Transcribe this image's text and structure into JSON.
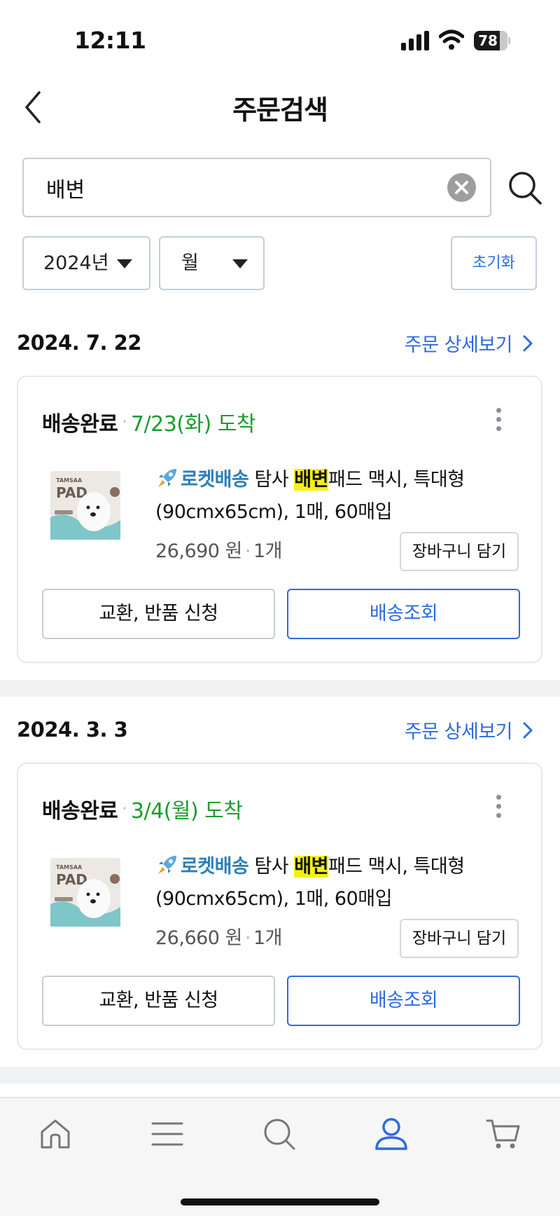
{
  "status_bar": {
    "time": "12:11",
    "battery": "78",
    "battery_level": 0.78
  },
  "header": {
    "title": "주문검색"
  },
  "search": {
    "value": "배변"
  },
  "filters": {
    "year": "2024년",
    "month": "월",
    "reset_label": "초기화"
  },
  "colors": {
    "accent": "#2d6be0",
    "arrival": "#1a9c2e",
    "highlight": "#f5f10e",
    "rocket": "#2f7fb8"
  },
  "orders": [
    {
      "date": "2024. 7. 22",
      "detail_label": "주문 상세보기",
      "status": "배송완료",
      "arrival": "7/23(화) 도착",
      "rocket_label": "로켓배송",
      "title_before": "탐사 ",
      "title_highlight": "배변",
      "title_after": "패드 맥시, 특대형 (90cmx65cm), 1매, 60매입",
      "price": "26,690 원",
      "quantity": "1개",
      "cart_label": "장바구니 담기",
      "exchange_label": "교환, 반품 신청",
      "tracking_label": "배송조회"
    },
    {
      "date": "2024. 3. 3",
      "detail_label": "주문 상세보기",
      "status": "배송완료",
      "arrival": "3/4(월) 도착",
      "rocket_label": "로켓배송",
      "title_before": "탐사 ",
      "title_highlight": "배변",
      "title_after": "패드 맥시, 특대형 (90cmx65cm), 1매, 60매입",
      "price": "26,660 원",
      "quantity": "1개",
      "cart_label": "장바구니 담기",
      "exchange_label": "교환, 반품 신청",
      "tracking_label": "배송조회"
    }
  ],
  "product_thumb": {
    "brand": "TAMSAA",
    "name": "PAD"
  },
  "bottom_nav": {
    "items": [
      {
        "icon": "home-icon",
        "active": false
      },
      {
        "icon": "menu-icon",
        "active": false
      },
      {
        "icon": "search-icon",
        "active": false
      },
      {
        "icon": "user-icon",
        "active": true
      },
      {
        "icon": "cart-icon",
        "active": false
      }
    ]
  }
}
